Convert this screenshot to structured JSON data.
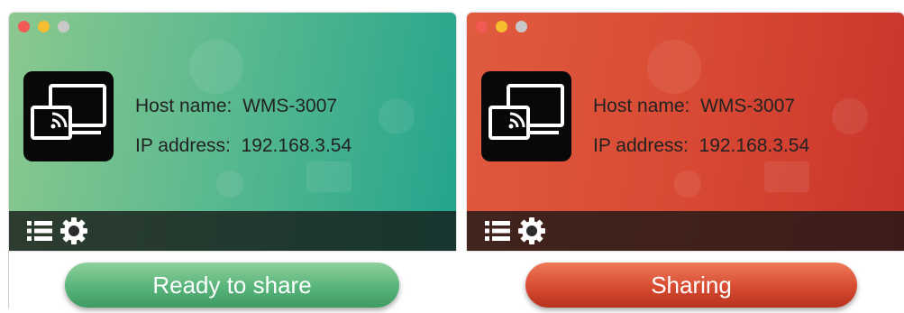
{
  "panels": [
    {
      "state": "ready",
      "host_label": "Host name:",
      "host_value": "WMS-3007",
      "ip_label": "IP address:",
      "ip_value": "192.168.3.54",
      "status_button": "Ready to share",
      "accent": "#23a48d"
    },
    {
      "state": "sharing",
      "host_label": "Host name:",
      "host_value": "WMS-3007",
      "ip_label": "IP address:",
      "ip_value": "192.168.3.54",
      "status_button": "Sharing",
      "accent": "#d94a34"
    }
  ],
  "icons": {
    "app": "screen-cast-icon",
    "menu": "list-icon",
    "settings": "gear-icon"
  }
}
